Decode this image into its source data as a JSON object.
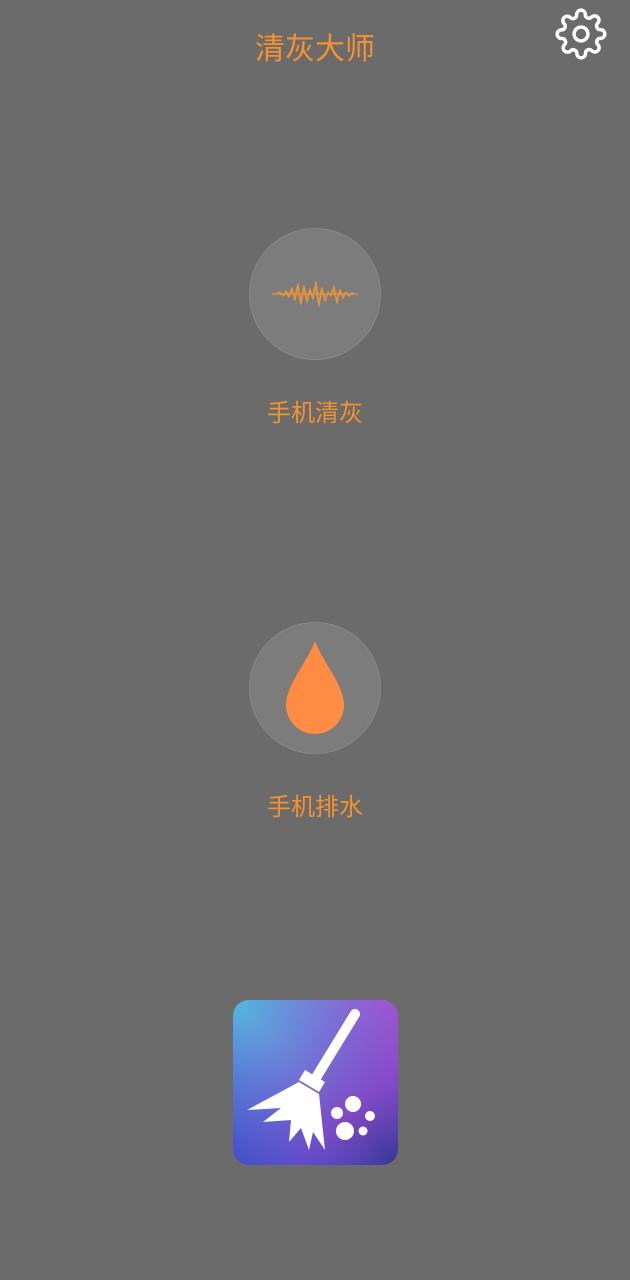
{
  "header": {
    "title": "清灰大师",
    "settings_icon": "gear-icon"
  },
  "features": [
    {
      "label": "手机清灰",
      "icon": "sound-wave-icon"
    },
    {
      "label": "手机排水",
      "icon": "water-drop-icon"
    }
  ],
  "promo": {
    "icon": "broom-cleaner-app-icon"
  },
  "colors": {
    "background": "#6b6b6b",
    "accent": "#f5912e",
    "circle": "#7c7c7c",
    "drop": "#ff8c42"
  }
}
